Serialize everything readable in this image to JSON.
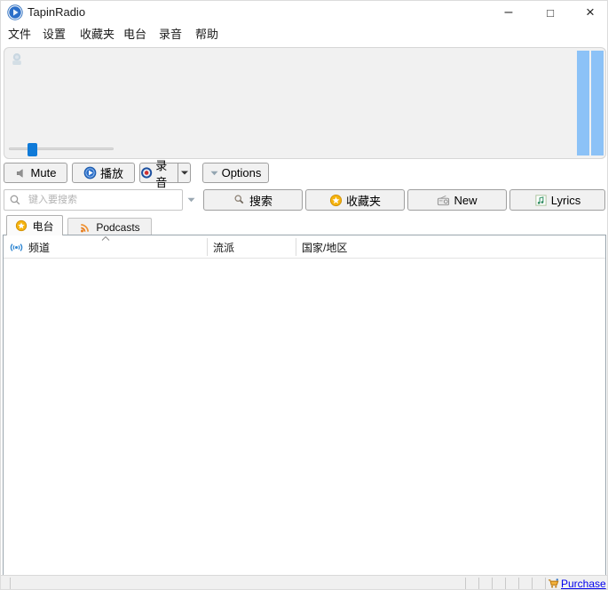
{
  "window": {
    "title": "TapinRadio",
    "controls": {
      "minimize": "–",
      "maximize": "□",
      "close": "×"
    }
  },
  "menu": {
    "items": [
      "文件",
      "设置",
      "收藏夹",
      "电台",
      "录音",
      "帮助"
    ]
  },
  "player": {
    "volume_slider_position_pct": 20,
    "vu_bars": 2
  },
  "toolbar": {
    "mute": "Mute",
    "play": "播放",
    "record": "录音",
    "options": "Options"
  },
  "search": {
    "placeholder": "键入要搜索",
    "value": "",
    "search_button": "搜索",
    "favorites_button": "收藏夹",
    "new_button": "New",
    "lyrics_button": "Lyrics"
  },
  "tabs": {
    "radio": "电台",
    "podcasts": "Podcasts"
  },
  "table": {
    "columns": [
      "频道",
      "流派",
      "国家/地区"
    ],
    "sorted_column": "频道",
    "sort_direction": "asc",
    "rows": []
  },
  "statusbar": {
    "purchase": "Purchase"
  },
  "colors": {
    "vu_bar_blue": "#8cc2f7",
    "slider_handle_blue": "#0f7ad8",
    "link_blue": "#0000ee",
    "star_gold": "#f6b40e",
    "rss_orange": "#e87b1a",
    "record_red": "#d03030",
    "play_blue": "#2b6fc9",
    "antenna_blue": "#2f86d2",
    "panel_gray": "#f1f1f1"
  }
}
